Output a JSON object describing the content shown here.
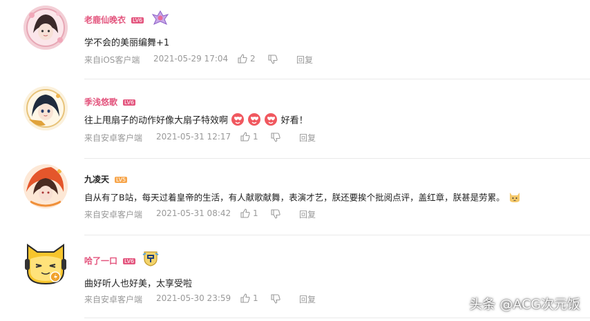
{
  "comments": [
    {
      "username": "老鹿仙晚衣",
      "level": "LV6",
      "text": "学不会的美丽编舞+1",
      "source": "来自iOS客户端",
      "time": "2021-05-29 17:04",
      "likes": "2",
      "reply": "回复"
    },
    {
      "username": "季浅悠歌",
      "level": "LV6",
      "text": "往上甩扇子的动作好像大扇子特效啊",
      "text_after": "好看！",
      "source": "来自安卓客户端",
      "time": "2021-05-31 12:17",
      "likes": "1",
      "reply": "回复"
    },
    {
      "username": "九凌天",
      "level": "LV5",
      "text": "自从有了B站，每天过着皇帝的生活，有人献歌献舞，表演才艺，朕还要挨个批阅点评，盖红章，朕甚是劳累。",
      "source": "来自安卓客户端",
      "time": "2021-05-31 08:42",
      "likes": "1",
      "reply": "回复"
    },
    {
      "username": "哈了一口",
      "level": "LV6",
      "text": "曲好听人也好美，太享受啦",
      "source": "来自安卓客户端",
      "time": "2021-05-30 23:59",
      "likes": "1",
      "reply": "回复"
    }
  ],
  "watermark": "头条 @ACG次元饭",
  "colors": {
    "username": "#e3547d",
    "username_plain": "#222222",
    "level_red": "#e3547d",
    "level_orange": "#f7a54a",
    "meta": "#999999"
  },
  "icons": [
    "thumb-up-icon",
    "thumb-down-icon",
    "heart-face-emoji",
    "cat-emoji",
    "medal-icon"
  ]
}
